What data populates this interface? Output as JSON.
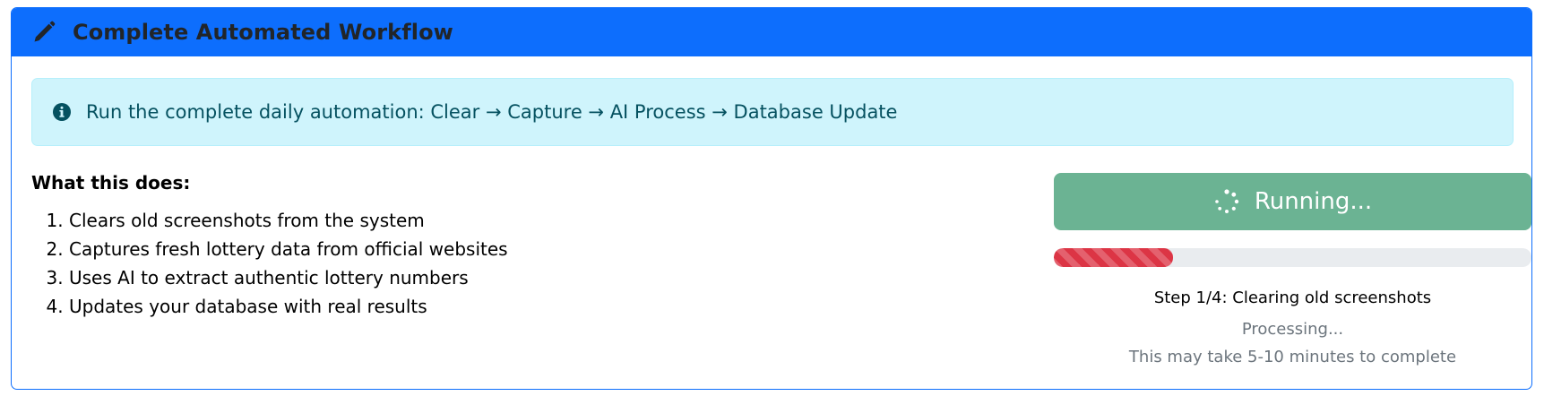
{
  "card": {
    "title": "Complete Automated Workflow",
    "title_icon": "pencil-icon",
    "header_color": "#0d6efd"
  },
  "alert": {
    "icon": "info-circle-icon",
    "text": "Run the complete daily automation: Clear → Capture → AI Process → Database Update"
  },
  "description": {
    "heading": "What this does:",
    "steps": [
      "Clears old screenshots from the system",
      "Captures fresh lottery data from official websites",
      "Uses AI to extract authentic lottery numbers",
      "Updates your database with real results"
    ]
  },
  "run": {
    "button_label": "Running...",
    "spinner_icon": "spinner-icon",
    "button_color": "#6bb393",
    "progress_fraction": 0.25,
    "progress_color": "#dc3545",
    "step_text": "Step 1/4: Clearing old screenshots",
    "status_text": "Processing...",
    "note_text": "This may take 5-10 minutes to complete"
  }
}
